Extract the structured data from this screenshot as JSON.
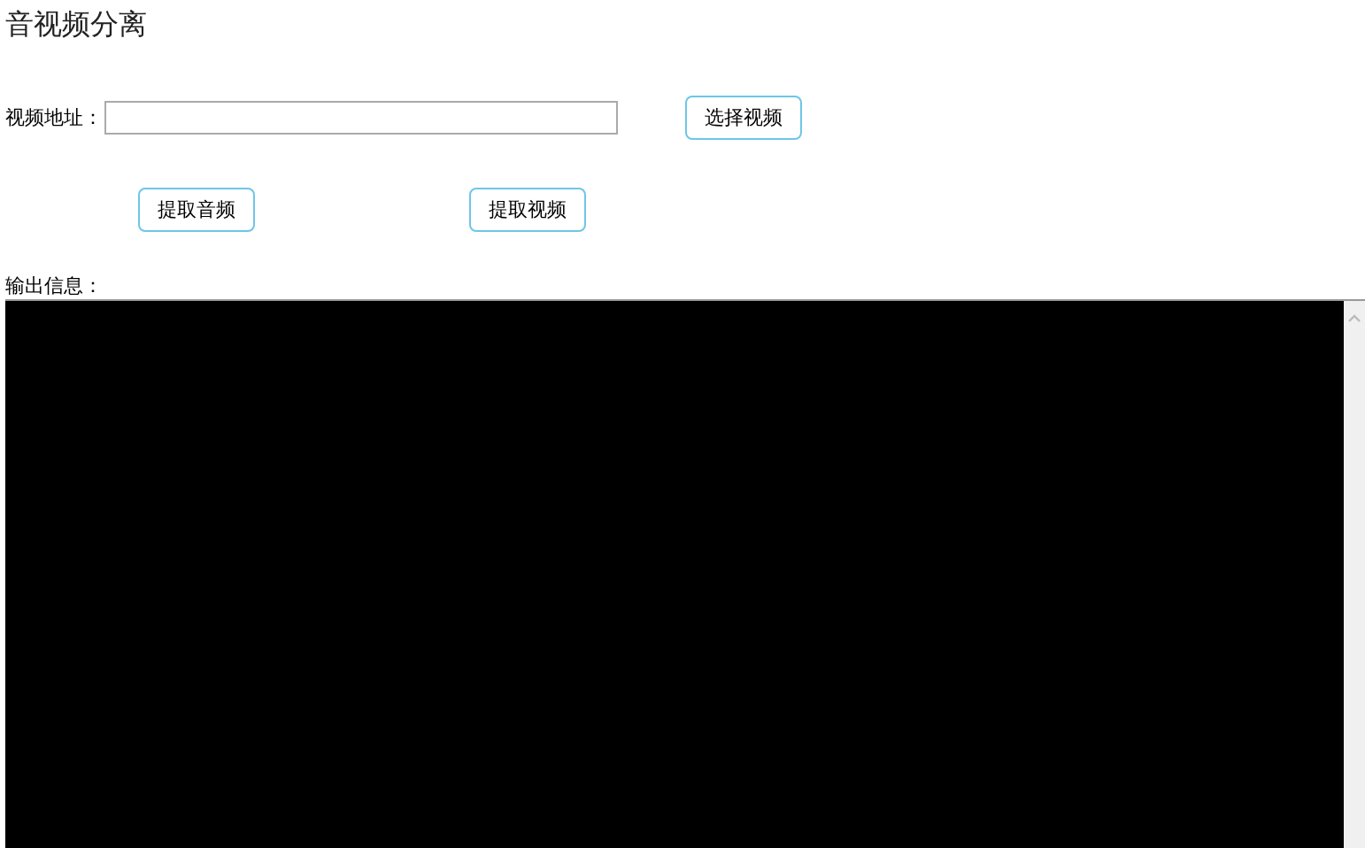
{
  "title": "音视频分离",
  "video_path": {
    "label": "视频地址："
  },
  "choose_button": "选择视频",
  "actions": [
    "提取音频",
    "提取视频"
  ],
  "output": {
    "label": "输出信息："
  }
}
